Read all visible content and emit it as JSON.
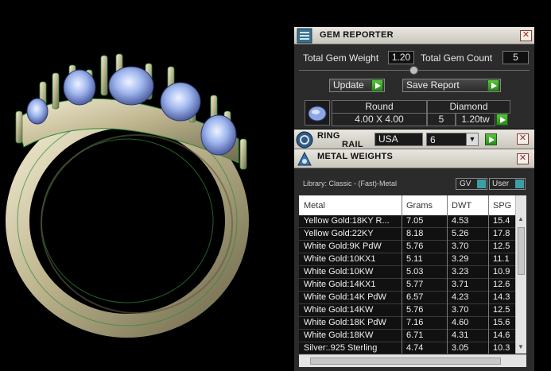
{
  "gem_reporter": {
    "title": "GEM REPORTER",
    "total_gem_weight_label": "Total Gem Weight",
    "total_gem_weight": "1.20",
    "total_gem_count_label": "Total Gem Count",
    "total_gem_count": "5",
    "update_label": "Update",
    "save_report_label": "Save Report",
    "gem": {
      "shape": "Round",
      "size": "4.00 X 4.00",
      "type": "Diamond",
      "count": "5",
      "weight": "1.20tw"
    }
  },
  "ring_rail": {
    "title_line1": "RING",
    "title_line2": "RAIL",
    "country": "USA",
    "size": "6"
  },
  "metal_weights": {
    "title": "METAL WEIGHTS",
    "library": "Library: Classic - (Fast)-Metal",
    "gv_label": "GV",
    "user_label": "User",
    "columns": [
      "Metal",
      "Grams",
      "DWT",
      "SPG"
    ],
    "rows": [
      [
        "Yellow Gold:18KY R...",
        "7.05",
        "4.53",
        "15.4"
      ],
      [
        "Yellow Gold:22KY",
        "8.18",
        "5.26",
        "17.8"
      ],
      [
        "White Gold:9K PdW",
        "5.76",
        "3.70",
        "12.5"
      ],
      [
        "White Gold:10KX1",
        "5.11",
        "3.29",
        "11.1"
      ],
      [
        "White Gold:10KW",
        "5.03",
        "3.23",
        "10.9"
      ],
      [
        "White Gold:14KX1",
        "5.77",
        "3.71",
        "12.6"
      ],
      [
        "White Gold:14K PdW",
        "6.57",
        "4.23",
        "14.3"
      ],
      [
        "White Gold:14KW",
        "5.76",
        "3.70",
        "12.5"
      ],
      [
        "White Gold:18K PdW",
        "7.16",
        "4.60",
        "15.6"
      ],
      [
        "White Gold:18KW",
        "6.71",
        "4.31",
        "14.6"
      ],
      [
        "Silver:.925 Sterling",
        "4.74",
        "3.05",
        "10.3"
      ]
    ]
  },
  "colors": {
    "panel_bg": "#2b2b2b",
    "titlebar": "#d9d6ce",
    "go_green": "#3fae2b",
    "close_red": "#9c2a2a",
    "gem_blue": "#9fb6ee"
  }
}
